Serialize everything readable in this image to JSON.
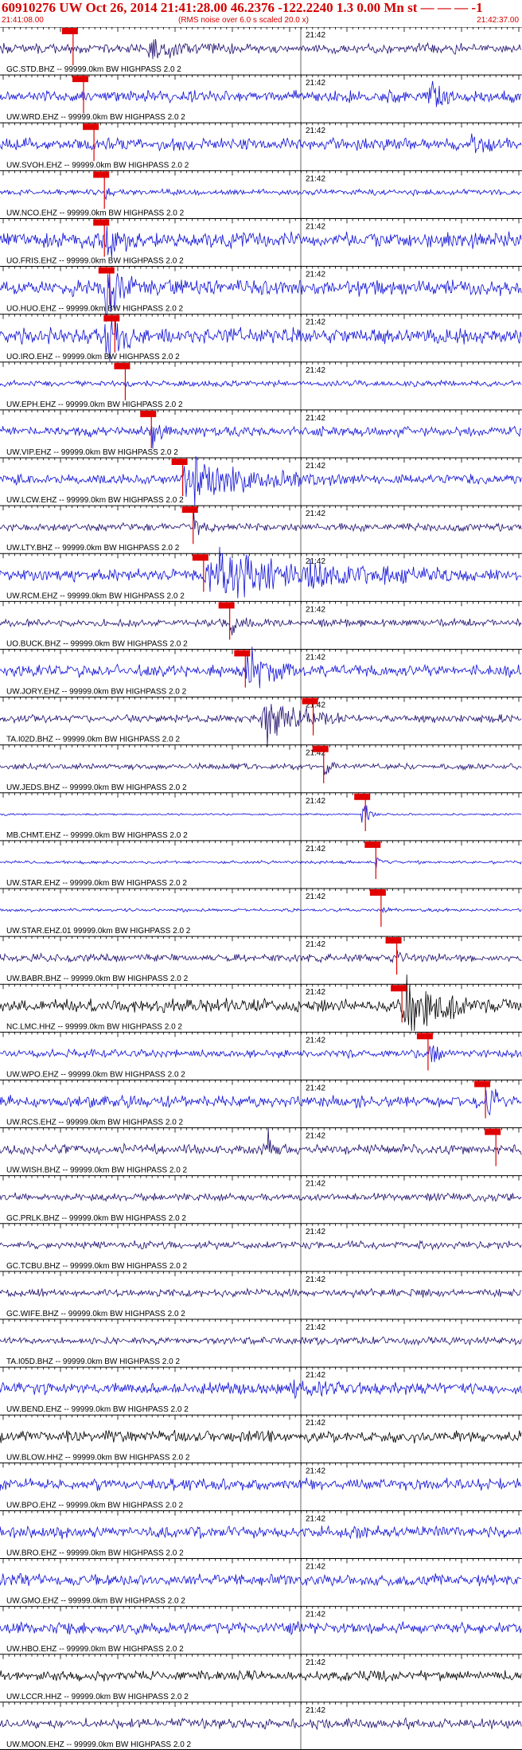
{
  "header": {
    "title": "60910276 UW Oct 26, 2014 21:41:28.00   46.2376 -122.2240  1.3 0.00 Mn st — — — -1",
    "start_time": "21:41:08.00",
    "rms_note": "(RMS noise over 6.0 s scaled 20.0 x)",
    "end_time": "21:42:37.00"
  },
  "minute_label": "21:42",
  "colors": {
    "header_text": "#d40000",
    "blue_trace": "#1010d8",
    "navy_trace": "#221070",
    "black_trace": "#000000",
    "pick_marker": "#e00000"
  },
  "channels": [
    {
      "label": "GC.STD.BHZ -- 99999.0km BW  HIGHPASS  2.0  2",
      "color": "navy",
      "pick": 0.14,
      "amp": 0.25,
      "burst": [
        0.28,
        0.45
      ],
      "burst_amp": 0.45
    },
    {
      "label": "UW.WRD.EHZ -- 99999.0km BW  HIGHPASS  2.0  2",
      "color": "blue",
      "pick": 0.16,
      "amp": 0.3,
      "burst": [
        0.82,
        0.9
      ],
      "burst_amp": 0.6
    },
    {
      "label": "UW.SVOH.EHZ -- 99999.0km BW  HIGHPASS  2.0  2",
      "color": "blue",
      "pick": 0.18,
      "amp": 0.3,
      "burst": [
        0.9,
        0.95
      ],
      "burst_amp": 0.5
    },
    {
      "label": "UW.NCO.EHZ -- 99999.0km BW  HIGHPASS  2.0  2",
      "color": "blue",
      "pick": 0.2,
      "amp": 0.15,
      "burst": [
        0.2,
        0.22
      ],
      "burst_amp": 0.4
    },
    {
      "label": "UO.FRIS.EHZ -- 99999.0km BW  HIGHPASS  2.0  2",
      "color": "blue",
      "pick": 0.2,
      "amp": 0.4,
      "burst": [
        0.2,
        0.26
      ],
      "burst_amp": 1.2
    },
    {
      "label": "UO.HUO.EHZ -- 99999.0km BW  HIGHPASS  2.0  2",
      "color": "blue",
      "pick": 0.21,
      "amp": 0.4,
      "burst": [
        0.2,
        0.27
      ],
      "burst_amp": 1.3
    },
    {
      "label": "UO.IRO.EHZ -- 99999.0km BW  HIGHPASS  2.0  2",
      "color": "blue",
      "pick": 0.22,
      "amp": 0.4,
      "burst": [
        0.2,
        0.27
      ],
      "burst_amp": 1.4
    },
    {
      "label": "UW.EPH.EHZ -- 99999.0km BW  HIGHPASS  2.0  2",
      "color": "blue",
      "pick": 0.24,
      "amp": 0.15,
      "burst": [
        0.24,
        0.26
      ],
      "burst_amp": 0.3
    },
    {
      "label": "UW.VIP.EHZ -- 99999.0km BW  HIGHPASS  2.0  2",
      "color": "blue",
      "pick": 0.29,
      "amp": 0.25,
      "burst": [
        0.29,
        0.33
      ],
      "burst_amp": 0.7
    },
    {
      "label": "UW.LCW.EHZ -- 99999.0km BW  HIGHPASS  2.0  2",
      "color": "blue",
      "pick": 0.35,
      "amp": 0.25,
      "burst": [
        0.35,
        0.65
      ],
      "burst_amp": 1.1
    },
    {
      "label": "UW.LTY.BHZ -- 99999.0km BW  HIGHPASS  2.0  2",
      "color": "navy",
      "pick": 0.37,
      "amp": 0.2,
      "burst": [
        0.37,
        0.4
      ],
      "burst_amp": 0.6
    },
    {
      "label": "UW.RCM.EHZ -- 99999.0km BW  HIGHPASS  2.0  2",
      "color": "blue",
      "pick": 0.39,
      "amp": 0.3,
      "burst": [
        0.39,
        0.9
      ],
      "burst_amp": 1.0
    },
    {
      "label": "UO.BUCK.BHZ -- 99999.0km BW  HIGHPASS  2.0  2",
      "color": "navy",
      "pick": 0.44,
      "amp": 0.2,
      "burst": [
        0.44,
        0.5
      ],
      "burst_amp": 0.4
    },
    {
      "label": "UW.JORY.EHZ -- 99999.0km BW  HIGHPASS  2.0  2",
      "color": "blue",
      "pick": 0.47,
      "amp": 0.3,
      "burst": [
        0.47,
        0.58
      ],
      "burst_amp": 1.0
    },
    {
      "label": "TA.I02D.BHZ -- 99999.0km BW  HIGHPASS  2.0  2",
      "color": "navy",
      "pick": 0.6,
      "amp": 0.2,
      "burst": [
        0.5,
        0.67
      ],
      "burst_amp": 1.0
    },
    {
      "label": "UW.JEDS.BHZ -- 99999.0km BW  HIGHPASS  2.0  2",
      "color": "navy",
      "pick": 0.62,
      "amp": 0.15,
      "burst": [
        0.62,
        0.66
      ],
      "burst_amp": 0.3
    },
    {
      "label": "MB.CHMT.EHZ -- 99999.0km BW  HIGHPASS  2.0  2",
      "color": "blue",
      "pick": 0.7,
      "amp": 0.05,
      "burst": [
        0.69,
        0.73
      ],
      "burst_amp": 0.7
    },
    {
      "label": "UW.STAR.EHZ -- 99999.0km BW  HIGHPASS  2.0  2",
      "color": "blue",
      "pick": 0.72,
      "amp": 0.08,
      "burst": [
        0.72,
        0.74
      ],
      "burst_amp": 0.3
    },
    {
      "label": "UW.STAR.EHZ.01 99999.0km BW  HIGHPASS  2.0  2",
      "color": "blue",
      "pick": 0.73,
      "amp": 0.08,
      "burst": [
        0.73,
        0.75
      ],
      "burst_amp": 0.3
    },
    {
      "label": "UW.BABR.BHZ -- 99999.0km BW  HIGHPASS  2.0  2",
      "color": "navy",
      "pick": 0.76,
      "amp": 0.2,
      "burst": [
        0.76,
        0.8
      ],
      "burst_amp": 0.3
    },
    {
      "label": "NC.LMC.HHZ -- 99999.0km BW  HIGHPASS  2.0  2",
      "color": "black",
      "pick": 0.77,
      "amp": 0.35,
      "burst": [
        0.77,
        0.99
      ],
      "burst_amp": 1.1
    },
    {
      "label": "UW.WPO.EHZ -- 99999.0km BW  HIGHPASS  2.0  2",
      "color": "blue",
      "pick": 0.82,
      "amp": 0.2,
      "burst": [
        0.82,
        0.86
      ],
      "burst_amp": 0.5
    },
    {
      "label": "UW.RCS.EHZ -- 99999.0km BW  HIGHPASS  2.0  2",
      "color": "blue",
      "pick": 0.93,
      "amp": 0.3,
      "burst": [
        0.93,
        0.99
      ],
      "burst_amp": 0.6
    },
    {
      "label": "UW.WISH.BHZ -- 99999.0km BW  HIGHPASS  2.0  2",
      "color": "navy",
      "pick": 0.95,
      "amp": 0.25,
      "burst": [
        0.51,
        0.54
      ],
      "burst_amp": 1.0
    },
    {
      "label": "GC.PRLK.BHZ -- 99999.0km BW  HIGHPASS  2.0  2",
      "color": "navy",
      "pick": null,
      "amp": 0.2,
      "burst": null,
      "burst_amp": 0
    },
    {
      "label": "GC.TCBU.BHZ -- 99999.0km BW  HIGHPASS  2.0  2",
      "color": "navy",
      "pick": null,
      "amp": 0.2,
      "burst": null,
      "burst_amp": 0
    },
    {
      "label": "GC.WIFE.BHZ -- 99999.0km BW  HIGHPASS  2.0  2",
      "color": "navy",
      "pick": null,
      "amp": 0.2,
      "burst": null,
      "burst_amp": 0
    },
    {
      "label": "TA.I05D.BHZ -- 99999.0km BW  HIGHPASS  2.0  2",
      "color": "navy",
      "pick": null,
      "amp": 0.2,
      "burst": null,
      "burst_amp": 0
    },
    {
      "label": "UW.BEND.EHZ -- 99999.0km BW  HIGHPASS  2.0  2",
      "color": "blue",
      "pick": null,
      "amp": 0.3,
      "burst": [
        0.55,
        0.7
      ],
      "burst_amp": 0.4
    },
    {
      "label": "UW.BLOW.HHZ -- 99999.0km BW  HIGHPASS  2.0  2",
      "color": "black",
      "pick": null,
      "amp": 0.3,
      "burst": null,
      "burst_amp": 0
    },
    {
      "label": "UW.BPO.EHZ -- 99999.0km BW  HIGHPASS  2.0  2",
      "color": "blue",
      "pick": null,
      "amp": 0.3,
      "burst": null,
      "burst_amp": 0
    },
    {
      "label": "UW.BRO.EHZ -- 99999.0km BW  HIGHPASS  2.0  2",
      "color": "blue",
      "pick": null,
      "amp": 0.3,
      "burst": null,
      "burst_amp": 0
    },
    {
      "label": "UW.GMO.EHZ -- 99999.0km BW  HIGHPASS  2.0  2",
      "color": "blue",
      "pick": null,
      "amp": 0.3,
      "burst": null,
      "burst_amp": 0
    },
    {
      "label": "UW.HBO.EHZ -- 99999.0km BW  HIGHPASS  2.0  2",
      "color": "blue",
      "pick": null,
      "amp": 0.3,
      "burst": null,
      "burst_amp": 0
    },
    {
      "label": "UW.LCCR.HHZ -- 99999.0km BW  HIGHPASS  2.0  2",
      "color": "black",
      "pick": null,
      "amp": 0.25,
      "burst": null,
      "burst_amp": 0
    },
    {
      "label": "UW.MOON.EHZ -- 99999.0km BW  HIGHPASS  2.0  2",
      "color": "navy",
      "pick": null,
      "amp": 0.25,
      "burst": null,
      "burst_amp": 0
    }
  ]
}
